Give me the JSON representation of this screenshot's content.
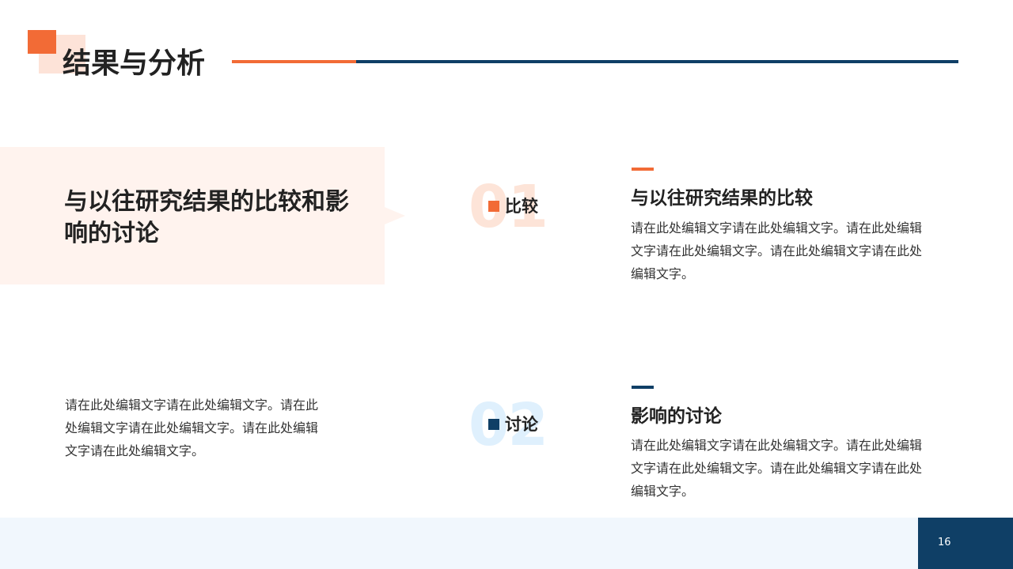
{
  "header": {
    "title": "结果与分析"
  },
  "panel": {
    "title": "与以往研究结果的比较和影响的讨论"
  },
  "left_body": "请在此处编辑文字请在此处编辑文字。请在此处编辑文字请在此处编辑文字。请在此处编辑文字请在此处编辑文字。",
  "items": [
    {
      "number": "01",
      "label": "比较",
      "title": "与以往研究结果的比较",
      "body": "请在此处编辑文字请在此处编辑文字。请在此处编辑文字请在此处编辑文字。请在此处编辑文字请在此处编辑文字。"
    },
    {
      "number": "02",
      "label": "讨论",
      "title": "影响的讨论",
      "body": "请在此处编辑文字请在此处编辑文字。请在此处编辑文字请在此处编辑文字。请在此处编辑文字请在此处编辑文字。"
    }
  ],
  "footer": {
    "page_number": "16"
  },
  "colors": {
    "accent_orange": "#f26b36",
    "accent_navy": "#0f3f66",
    "panel_bg": "#fff3ee",
    "footer_bg": "#f1f7fd"
  }
}
